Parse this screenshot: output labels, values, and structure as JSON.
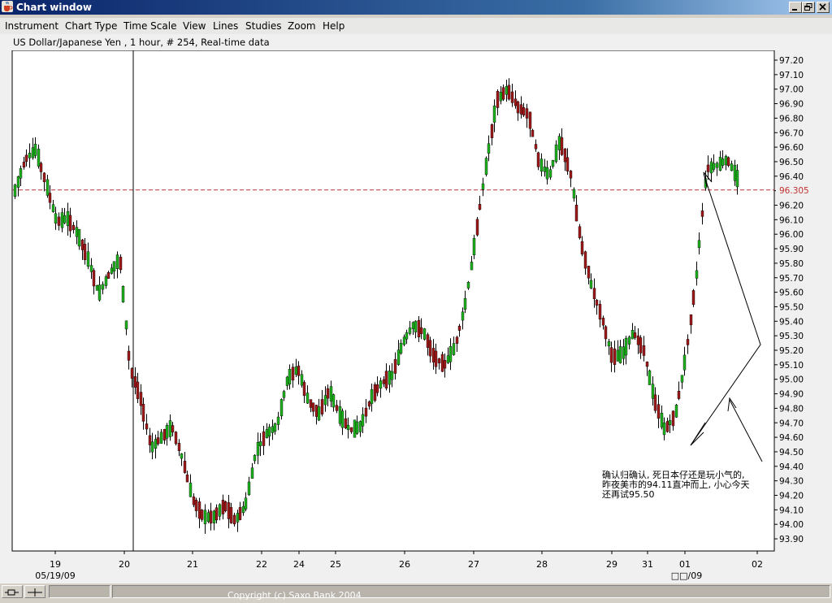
{
  "window": {
    "title": "Chart window",
    "buttons": [
      "minimize-button",
      "restore-button",
      "close-button"
    ]
  },
  "menu": [
    "Instrument",
    "Chart Type",
    "Time Scale",
    "View",
    "Lines",
    "Studies",
    "Zoom",
    "Help"
  ],
  "chart_header": "US Dollar/Japanese Yen , 1 hour, # 254, Real-time data",
  "colors": {
    "up_candle": "#1db31d",
    "down_candle": "#a01818",
    "wick": "#000000",
    "price_line": "#c03030",
    "titlebar": "#0a246a"
  },
  "chart_data": {
    "type": "candlestick",
    "title": "US Dollar/Japanese Yen , 1 hour, # 254, Real-time data",
    "ylim": [
      93.8,
      97.25
    ],
    "yticks": [
      "97.20",
      "97.10",
      "97.00",
      "96.90",
      "96.80",
      "96.70",
      "96.60",
      "96.50",
      "96.40",
      "96.30",
      "96.20",
      "96.10",
      "96.00",
      "95.90",
      "95.80",
      "95.70",
      "95.60",
      "95.50",
      "95.40",
      "95.30",
      "95.20",
      "95.10",
      "95.00",
      "94.90",
      "94.80",
      "94.70",
      "94.60",
      "94.50",
      "94.40",
      "94.30",
      "94.20",
      "94.10",
      "94.00",
      "93.90"
    ],
    "current_price": "96.305",
    "xticks": [
      "19",
      "20",
      "21",
      "22",
      "24",
      "25",
      "26",
      "27",
      "28",
      "29",
      "31",
      "01",
      "02"
    ],
    "xsub_left": "05/19/09",
    "xsub_right": "□□/09",
    "annotation": [
      "确认归确认, 死日本仔还是玩小气的,",
      "昨夜美市的94.11直冲而上, 小心今天",
      "还再试95.50"
    ],
    "session_marker_date": "20",
    "path": [
      [
        96.22,
        96.38
      ],
      [
        96.45,
        96.58
      ],
      [
        96.45,
        96.72
      ],
      [
        96.2,
        96.48
      ],
      [
        95.95,
        96.22
      ],
      [
        96.0,
        96.22
      ],
      [
        95.85,
        96.15
      ],
      [
        95.7,
        95.95
      ],
      [
        95.45,
        95.72
      ],
      [
        95.6,
        95.85
      ],
      [
        95.95,
        95.72
      ],
      [
        94.95,
        95.2
      ],
      [
        94.78,
        94.95
      ],
      [
        94.4,
        94.65
      ],
      [
        94.48,
        94.72
      ],
      [
        94.55,
        94.8
      ],
      [
        94.35,
        94.55
      ],
      [
        94.08,
        94.25
      ],
      [
        93.9,
        94.2
      ],
      [
        93.95,
        94.15
      ],
      [
        94.05,
        94.22
      ],
      [
        93.95,
        94.1
      ],
      [
        94.0,
        94.25
      ],
      [
        94.4,
        94.6
      ],
      [
        94.5,
        94.75
      ],
      [
        94.6,
        94.75
      ],
      [
        94.9,
        95.1
      ],
      [
        95.1,
        95.05
      ],
      [
        94.75,
        94.95
      ],
      [
        94.7,
        94.82
      ],
      [
        94.85,
        95.0
      ],
      [
        94.7,
        94.8
      ],
      [
        94.55,
        94.75
      ],
      [
        94.55,
        94.8
      ],
      [
        94.75,
        95.0
      ],
      [
        94.9,
        95.05
      ],
      [
        94.95,
        95.1
      ],
      [
        95.15,
        95.35
      ],
      [
        95.3,
        95.45
      ],
      [
        95.25,
        95.4
      ],
      [
        95.05,
        95.25
      ],
      [
        95.0,
        95.2
      ],
      [
        95.15,
        95.3
      ],
      [
        95.4,
        95.65
      ],
      [
        95.9,
        96.1
      ],
      [
        96.4,
        96.6
      ],
      [
        96.85,
        97.0
      ],
      [
        96.9,
        97.1
      ],
      [
        96.8,
        96.95
      ],
      [
        96.9,
        96.75
      ],
      [
        96.4,
        96.6
      ],
      [
        96.5,
        96.3
      ],
      [
        96.55,
        96.75
      ],
      [
        96.35,
        96.5
      ],
      [
        95.85,
        96.05
      ],
      [
        95.55,
        95.75
      ],
      [
        95.35,
        95.5
      ],
      [
        95.05,
        95.25
      ],
      [
        95.05,
        95.3
      ],
      [
        95.2,
        95.45
      ],
      [
        95.1,
        95.3
      ],
      [
        94.78,
        94.95
      ],
      [
        94.55,
        94.75
      ],
      [
        94.6,
        94.9
      ],
      [
        95.0,
        95.3
      ],
      [
        95.5,
        95.9
      ],
      [
        96.3,
        96.6
      ],
      [
        96.4,
        96.55
      ],
      [
        96.45,
        96.58
      ],
      [
        96.3,
        96.45
      ]
    ]
  },
  "status": {
    "copyright": "Copyright (c) Saxo Bank 2004"
  }
}
